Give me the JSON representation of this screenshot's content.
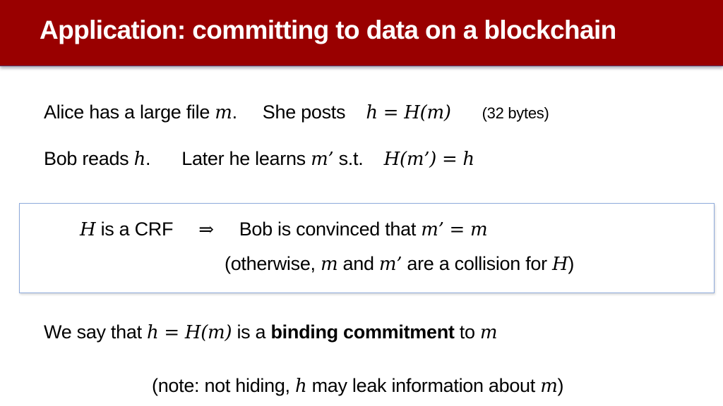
{
  "slide": {
    "title": "Application:  committing to data on a blockchain",
    "colors": {
      "header_bg": "#990000",
      "title_text": "#ffffff",
      "box_border": "#8eaadb"
    },
    "line1": {
      "text_a": "Alice has a large file ",
      "math_a": "m",
      "text_b": ".",
      "text_c": "She posts ",
      "math_b": "h = H(m)",
      "note": "(32 bytes)"
    },
    "line2": {
      "text_a": "Bob reads ",
      "math_a": "h",
      "text_b": ".",
      "text_c": "Later he learns ",
      "math_b": "m’",
      "text_d": " s.t. ",
      "math_c": "H(m’) = h"
    },
    "box": {
      "row1": {
        "math_a": "H",
        "text_a": " is a CRF",
        "arrow": "⇒",
        "text_b": "Bob is convinced that ",
        "math_b": "m’ = m"
      },
      "row2": {
        "text_a": "(otherwise, ",
        "math_a": "m",
        "text_b": " and ",
        "math_b": "m’",
        "text_c": "  are a collision for ",
        "math_c": "H",
        "text_d": ")"
      }
    },
    "line3": {
      "text_a": "We say that ",
      "math_a": "h = H(m)",
      "text_b": " is a ",
      "bold": "binding commitment",
      "text_c": " to ",
      "math_b": "m"
    },
    "line4": {
      "text_a": "(note:  not hiding,  ",
      "math_a": "h",
      "text_b": " may leak information about ",
      "math_b": "m",
      "text_c": ")"
    }
  }
}
